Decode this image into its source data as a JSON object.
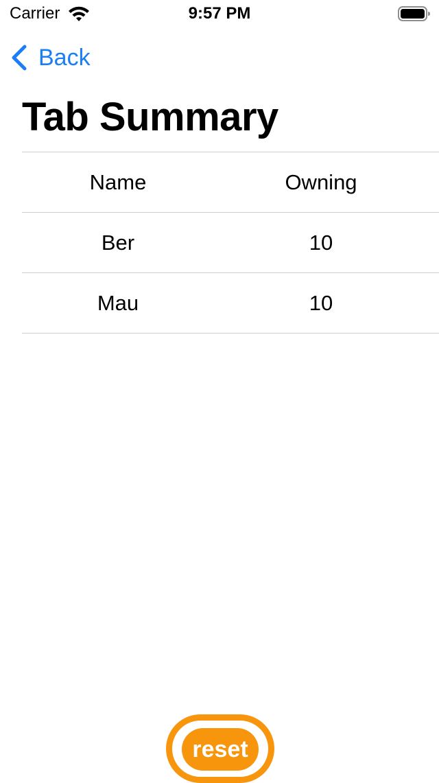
{
  "status_bar": {
    "carrier": "Carrier",
    "time": "9:57 PM",
    "icons": [
      "wifi-icon",
      "battery-icon"
    ]
  },
  "nav": {
    "back_label": "Back",
    "back_icon": "chevron-left-icon"
  },
  "page": {
    "title": "Tab Summary"
  },
  "table": {
    "columns": [
      "Name",
      "Owning"
    ],
    "rows": [
      {
        "name": "Ber",
        "owning": "10"
      },
      {
        "name": "Mau",
        "owning": "10"
      }
    ]
  },
  "reset_button": {
    "label": "reset"
  },
  "colors": {
    "accent": "#1c7ef4",
    "reset": "#f7950d",
    "divider": "#cfcfcf"
  }
}
